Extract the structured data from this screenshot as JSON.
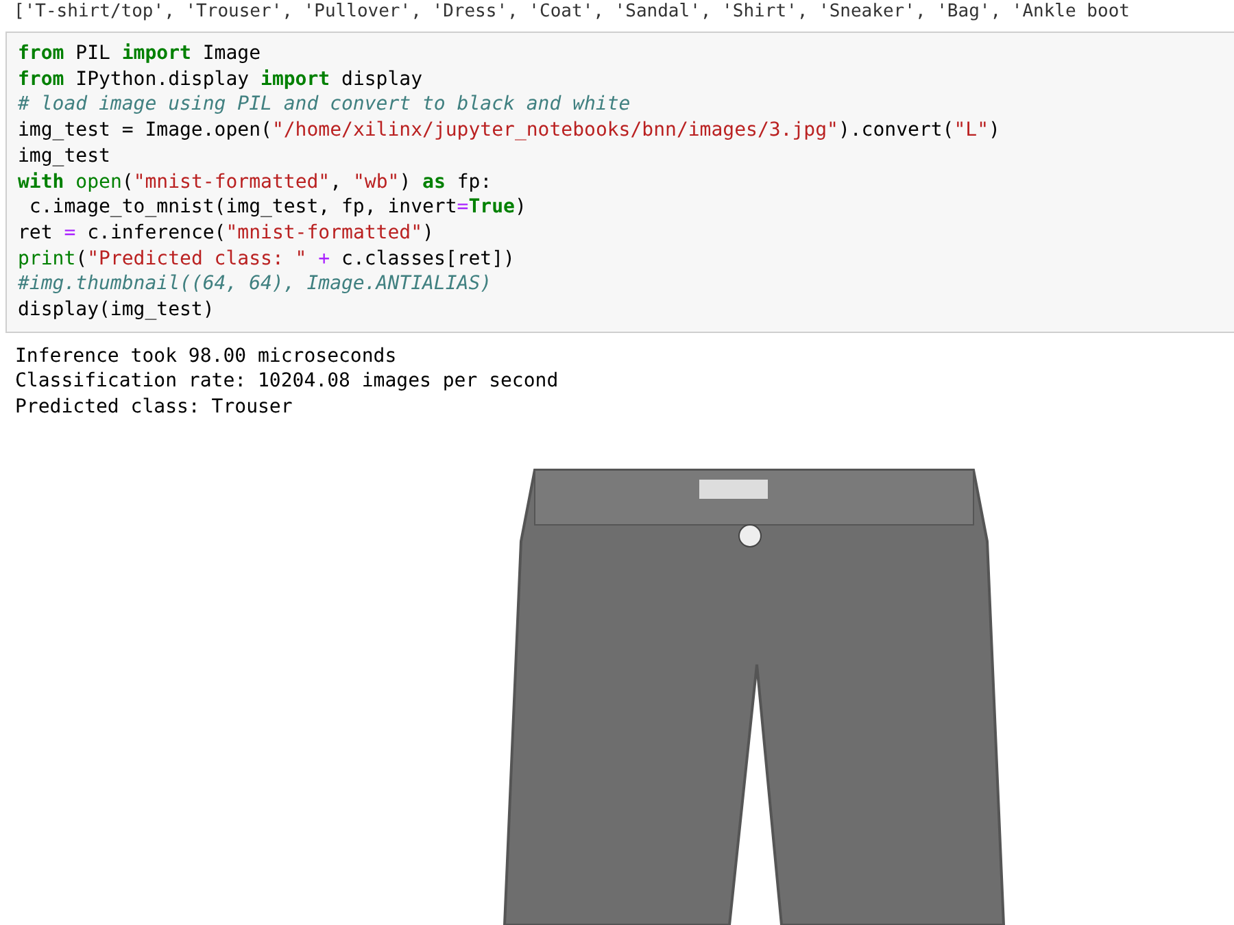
{
  "previous_output": "['T-shirt/top', 'Trouser', 'Pullover', 'Dress', 'Coat', 'Sandal', 'Shirt', 'Sneaker', 'Bag', 'Ankle boot",
  "code_cell": {
    "lines": [
      [
        {
          "kind": "kw",
          "text": "from"
        },
        {
          "kind": "plain",
          "text": " PIL "
        },
        {
          "kind": "kw",
          "text": "import"
        },
        {
          "kind": "plain",
          "text": " Image"
        }
      ],
      [
        {
          "kind": "kw",
          "text": "from"
        },
        {
          "kind": "plain",
          "text": " IPython.display "
        },
        {
          "kind": "kw",
          "text": "import"
        },
        {
          "kind": "plain",
          "text": " display"
        }
      ],
      [
        {
          "kind": "comment",
          "text": "# load image using PIL and convert to black and white"
        }
      ],
      [
        {
          "kind": "plain",
          "text": "img_test = Image.open("
        },
        {
          "kind": "str",
          "text": "\"/home/xilinx/jupyter_notebooks/bnn/images/3.jpg\""
        },
        {
          "kind": "plain",
          "text": ").convert("
        },
        {
          "kind": "str",
          "text": "\"L\""
        },
        {
          "kind": "plain",
          "text": ")"
        }
      ],
      [
        {
          "kind": "plain",
          "text": "img_test"
        }
      ],
      [
        {
          "kind": "kw",
          "text": "with "
        },
        {
          "kind": "builtin",
          "text": "open"
        },
        {
          "kind": "plain",
          "text": "("
        },
        {
          "kind": "str",
          "text": "\"mnist-formatted\""
        },
        {
          "kind": "plain",
          "text": ", "
        },
        {
          "kind": "str",
          "text": "\"wb\""
        },
        {
          "kind": "plain",
          "text": ") "
        },
        {
          "kind": "kw",
          "text": "as"
        },
        {
          "kind": "plain",
          "text": " fp:"
        }
      ],
      [
        {
          "kind": "plain",
          "text": " c.image_to_mnist(img_test, fp, invert"
        },
        {
          "kind": "op",
          "text": "="
        },
        {
          "kind": "kw",
          "text": "True"
        },
        {
          "kind": "plain",
          "text": ")"
        }
      ],
      [
        {
          "kind": "plain",
          "text": "ret "
        },
        {
          "kind": "op",
          "text": "="
        },
        {
          "kind": "plain",
          "text": " c.inference("
        },
        {
          "kind": "str",
          "text": "\"mnist-formatted\""
        },
        {
          "kind": "plain",
          "text": ")"
        }
      ],
      [
        {
          "kind": "builtin",
          "text": "print"
        },
        {
          "kind": "plain",
          "text": "("
        },
        {
          "kind": "str",
          "text": "\"Predicted class: \""
        },
        {
          "kind": "op",
          "text": " +"
        },
        {
          "kind": "plain",
          "text": " c.classes[ret])"
        }
      ],
      [
        {
          "kind": "comment",
          "text": "#img.thumbnail((64, 64), Image.ANTIALIAS)"
        }
      ],
      [
        {
          "kind": "plain",
          "text": "display(img_test)"
        }
      ]
    ]
  },
  "output": {
    "lines": [
      "Inference took 98.00 microseconds",
      "Classification rate: 10204.08 images per second",
      "Predicted class: Trouser"
    ]
  }
}
